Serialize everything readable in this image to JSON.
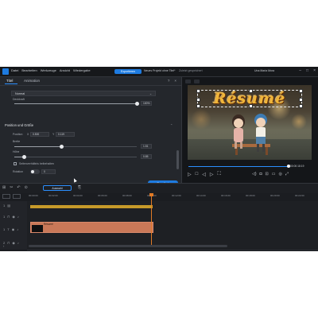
{
  "window": {
    "menu": [
      "Datei",
      "Bearbeiten",
      "Werkzeuge",
      "Ansicht",
      "Wiedergabe"
    ],
    "primary_button": "Exportieren",
    "project_title": "Neues Projekt ohne Titel*",
    "save_status": "Zuletzt gespeichert",
    "user_name": "Una Maria Mora"
  },
  "panel": {
    "tabs": [
      "Titel",
      "Animation"
    ],
    "blend_mode": "Normal",
    "opacity_label": "Deckkraft",
    "opacity_value": "100%",
    "opacity_level": 1.0,
    "section_title": "Position und Größe",
    "position_label": "Position",
    "pos_x_label": "X",
    "pos_x": "0.500",
    "pos_y_label": "Y",
    "pos_y": "0.119",
    "width_label": "Breite",
    "width_value": "1.51",
    "width_level": 0.38,
    "height_label": "Höhe",
    "height_value": "0.85",
    "height_level": 0.08,
    "keyframe_checkbox": "Seitenverhältnis beibehalten",
    "rotation_label": "Rotation",
    "rotation_value": "0",
    "more_button": "Erweitert"
  },
  "preview": {
    "title_text": "Résumé",
    "timecode": "00:00:18:19",
    "progress": 1.0
  },
  "timeline": {
    "active_tool": "Auswahl",
    "ticks": [
      "00:00:00",
      "00:02:00",
      "00:04:00",
      "00:06:00",
      "00:08:00",
      "00:10:00",
      "00:12:00",
      "00:14:00",
      "00:16:00",
      "00:18:00",
      "00:20:00",
      "00:22:00"
    ],
    "tracks": [
      {
        "id": "1",
        "kind": "video"
      },
      {
        "id": "1",
        "kind": "title"
      },
      {
        "id": "2",
        "kind": "audio"
      }
    ],
    "title_clip_label": "Résumé"
  }
}
